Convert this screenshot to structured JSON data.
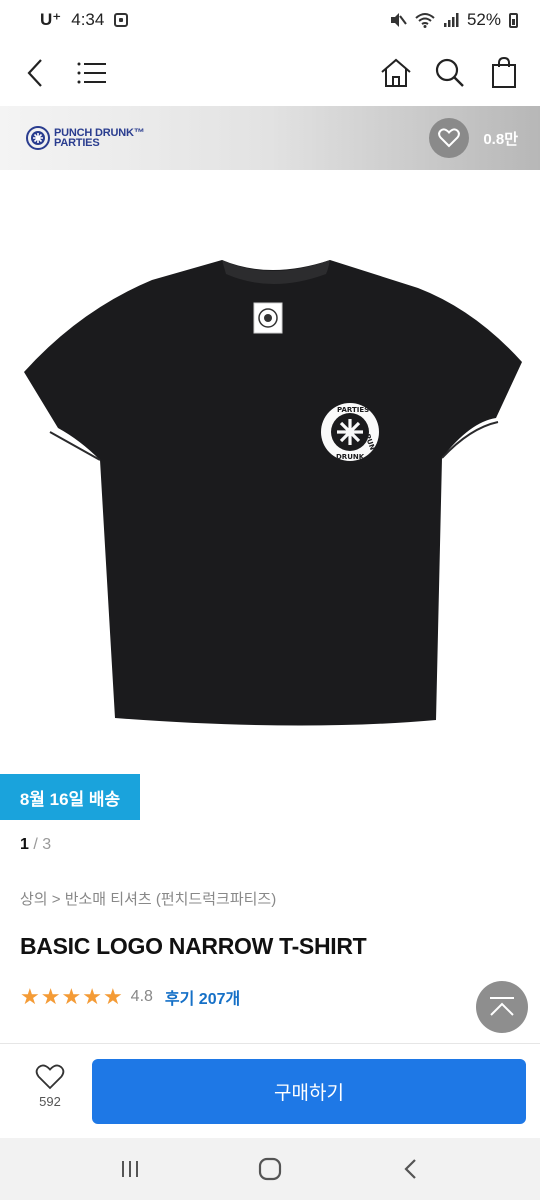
{
  "status_bar": {
    "carrier": "U⁺",
    "time": "4:34",
    "battery": "52%"
  },
  "nav": {
    "icons": [
      "back-icon",
      "menu-icon",
      "home-icon",
      "search-icon",
      "cart-icon"
    ]
  },
  "brand": {
    "name_line1": "PUNCH DRUNK™",
    "name_line2": "PARTIES",
    "likes": "0.8만"
  },
  "product": {
    "delivery_badge": "8월 16일 배송",
    "pager_current": "1",
    "pager_total": "/ 3",
    "breadcrumb": "상의 > 반소매 티셔츠 (펀치드럭크파티즈)",
    "title": "BASIC LOGO NARROW T-SHIRT",
    "rating_stars": 5,
    "rating": "4.8",
    "reviews": "후기 207개",
    "print_text_top": "PARTIES",
    "print_text_side": "PUNCH",
    "print_text_bottom": "DRUNK"
  },
  "bottom_bar": {
    "wish_count": "592",
    "buy_label": "구매하기"
  },
  "colors": {
    "accent_blue": "#1e78e6",
    "delivery_blue": "#1aa3dc",
    "star_orange": "#f49b36",
    "brand_navy": "#2a3d8f"
  }
}
